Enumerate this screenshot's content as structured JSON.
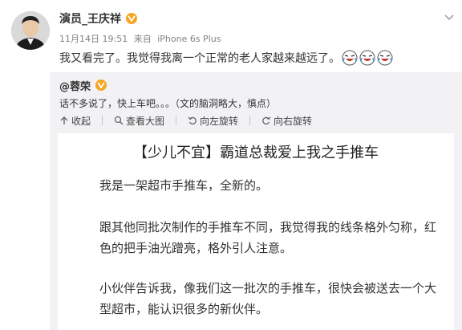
{
  "post": {
    "author": "演员_王庆祥",
    "date": "11月14日 19:51",
    "source_prefix": "来自",
    "source": "iPhone 6s Plus",
    "text": "我又看完了。我觉得我离一个正常的老人家越来越远了。",
    "emojis": [
      "laughing-cry-emoji",
      "laughing-cry-emoji",
      "laughing-cry-emoji"
    ]
  },
  "repost": {
    "author": "@蓉荣",
    "text": "话不多说了，快上车吧。。。（文的脑洞略大，慎点）",
    "actions": [
      {
        "label": "收起",
        "icon": "collapse-icon"
      },
      {
        "label": "查看大图",
        "icon": "magnify-icon"
      },
      {
        "label": "向左旋转",
        "icon": "rotate-left-icon"
      },
      {
        "label": "向右旋转",
        "icon": "rotate-right-icon"
      }
    ]
  },
  "article": {
    "title": "【少儿不宜】霸道总裁爱上我之手推车",
    "paragraphs": [
      "我是一架超市手推车，全新的。",
      "跟其他同批次制作的手推车不同，我觉得我的线条格外匀称，红色的把手油光蹭亮，格外引人注意。",
      "小伙伴告诉我，像我们这一批次的手推车，很快会被送去一个大型超市，能认识很多的新伙伴。"
    ]
  },
  "colors": {
    "badge": "#f5a623",
    "repost_bg": "#f2f2f5",
    "meta": "#808080"
  }
}
